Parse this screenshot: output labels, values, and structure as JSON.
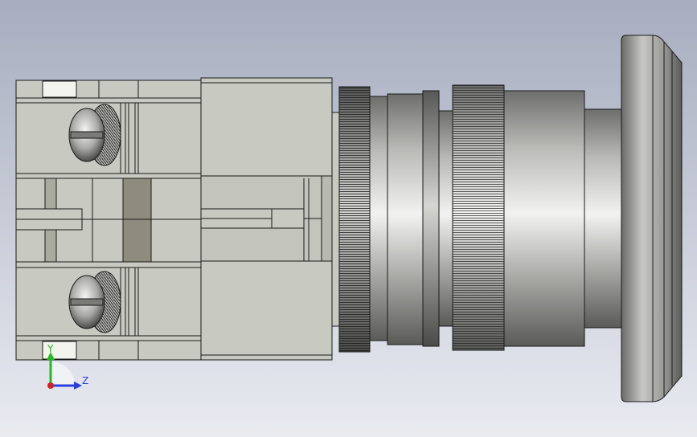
{
  "viewport": {
    "background_top": "#a7adbf",
    "background_bottom": "#e9ebf1"
  },
  "part": {
    "body_color": "#c8c9c0",
    "edge_color": "#1a1a1a",
    "metal_light": "#e4e4e2",
    "metal_dark": "#5c5c5a",
    "insert_color": "#8d8c7e"
  },
  "triad": {
    "y_label": "Y",
    "z_label": "Z",
    "y_color": "#22bb22",
    "z_color": "#2b3fe0",
    "origin_color": "#d42020"
  }
}
